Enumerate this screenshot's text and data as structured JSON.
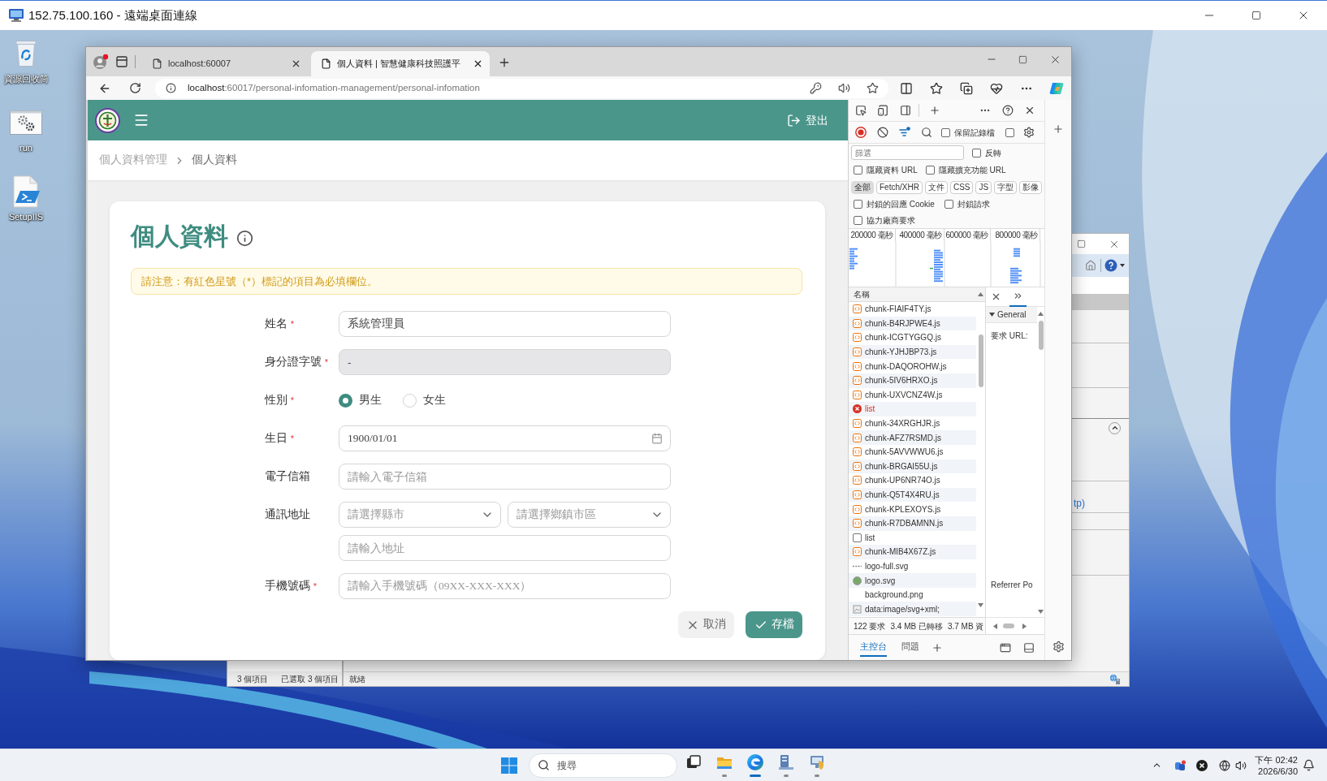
{
  "remote_desktop": {
    "title": "152.75.100.160 - 遠端桌面連線"
  },
  "desktop_icons": [
    {
      "kind": "recycle_bin",
      "label": "資源回收筒"
    },
    {
      "kind": "gears",
      "label": "run"
    },
    {
      "kind": "script",
      "label": "SetupIIS"
    }
  ],
  "browser": {
    "tabs": [
      {
        "title": "localhost:60007",
        "selected": false
      },
      {
        "title": "個人資料 | 智慧健康科技照護平",
        "selected": true
      }
    ],
    "address": {
      "host": "localhost",
      "rest": ":60017/personal-infomation-management/personal-infomation"
    }
  },
  "page": {
    "header": {
      "logout": "登出"
    },
    "breadcrumb": [
      {
        "label": "個人資料管理",
        "current": false
      },
      {
        "label": "個人資料",
        "current": true
      }
    ],
    "title": "個人資料",
    "notice": "請注意：有紅色星號（*）標記的項目為必填欄位。",
    "fields": [
      {
        "kind": "text",
        "label": "姓名",
        "required_mark": "*",
        "value": "系統管理員",
        "disabled": false
      },
      {
        "kind": "text",
        "label": "身分證字號",
        "required_mark": "*",
        "value": "-",
        "disabled": true
      },
      {
        "kind": "radio",
        "label": "性別",
        "required_mark": "*",
        "disabled": false,
        "options": [
          {
            "label": "男生",
            "selected": true
          },
          {
            "label": "女生",
            "selected": false
          }
        ]
      },
      {
        "kind": "date",
        "label": "生日",
        "required_mark": "*",
        "value": "1900/01/01",
        "disabled": false
      },
      {
        "kind": "text",
        "label": "電子信箱",
        "placeholder": "請輸入電子信箱",
        "disabled": false
      },
      {
        "kind": "address",
        "label": "通訊地址",
        "disabled": false,
        "selects": [
          {
            "placeholder": "請選擇縣市"
          },
          {
            "placeholder": "請選擇鄉鎮市區"
          }
        ],
        "placeholder": "請輸入地址"
      },
      {
        "kind": "tel",
        "label": "手機號碼",
        "required_mark": "*",
        "placeholder": "請輸入手機號碼（09XX-XXX-XXX）",
        "disabled": false
      }
    ],
    "buttons": [
      {
        "kind": "cancel",
        "label": "取消"
      },
      {
        "kind": "save",
        "label": "存檔"
      }
    ]
  },
  "devtools": {
    "record_options": [
      {
        "label": "保留記錄檔",
        "checked": false
      },
      {
        "checked": false
      }
    ],
    "filter": {
      "placeholder": "篩選"
    },
    "invert": {
      "label": "反轉",
      "checked": false
    },
    "hide_options": [
      {
        "label": "隱藏資料 URL",
        "checked": false
      },
      {
        "label": "隱藏擴充功能 URL",
        "checked": false
      }
    ],
    "type_filters": [
      {
        "label": "全部",
        "selected": true
      },
      {
        "label": "Fetch/XHR",
        "selected": false
      },
      {
        "label": "文件",
        "selected": false
      },
      {
        "label": "CSS",
        "selected": false
      },
      {
        "label": "JS",
        "selected": false
      },
      {
        "label": "字型",
        "selected": false
      },
      {
        "label": "影像",
        "selected": false
      }
    ],
    "block_options": [
      {
        "label": "封鎖的回應 Cookie",
        "checked": false
      },
      {
        "label": "封鎖請求",
        "checked": false
      }
    ],
    "third_party": {
      "label": "協力廠商要求",
      "checked": false
    },
    "overview_ticks": [
      "200000 毫秒",
      "400000 毫秒",
      "600000 毫秒",
      "800000 毫秒"
    ],
    "requests": {
      "column": "名稱",
      "rows": [
        {
          "name": "chunk-FIAIF4TY.js",
          "kind": "script"
        },
        {
          "name": "chunk-B4RJPWE4.js",
          "kind": "script"
        },
        {
          "name": "chunk-ICGTYGGQ.js",
          "kind": "script"
        },
        {
          "name": "chunk-YJHJBP73.js",
          "kind": "script"
        },
        {
          "name": "chunk-DAQOROHW.js",
          "kind": "script"
        },
        {
          "name": "chunk-5IV6HRXO.js",
          "kind": "script"
        },
        {
          "name": "chunk-UXVCNZ4W.js",
          "kind": "script"
        },
        {
          "name": "list",
          "kind": "failed"
        },
        {
          "name": "chunk-34XRGHJR.js",
          "kind": "script"
        },
        {
          "name": "chunk-AFZ7RSMD.js",
          "kind": "script"
        },
        {
          "name": "chunk-5AVVWWU6.js",
          "kind": "script"
        },
        {
          "name": "chunk-BRGAI55U.js",
          "kind": "script"
        },
        {
          "name": "chunk-UP6NR74O.js",
          "kind": "script"
        },
        {
          "name": "chunk-Q5T4X4RU.js",
          "kind": "script"
        },
        {
          "name": "chunk-KPLEXOYS.js",
          "kind": "script"
        },
        {
          "name": "chunk-R7DBAMNN.js",
          "kind": "script"
        },
        {
          "name": "list",
          "kind": "fetch"
        },
        {
          "name": "chunk-MIB4X67Z.js",
          "kind": "script"
        },
        {
          "name": "logo-full.svg",
          "kind": "image_line"
        },
        {
          "name": "logo.svg",
          "kind": "image_round"
        },
        {
          "name": "background.png",
          "kind": "plain"
        },
        {
          "name": "data:image/svg+xml;",
          "kind": "data"
        }
      ]
    },
    "details": {
      "section": "General",
      "fields": [
        "要求 URL:",
        "Referrer Po"
      ]
    },
    "summary": [
      "122 要求",
      "3.4 MB 已轉移",
      "3.7 MB 資"
    ],
    "drawer_tabs": [
      {
        "label": "主控台",
        "selected": true
      },
      {
        "label": "問題",
        "selected": false
      }
    ]
  },
  "explorer_window": {
    "status": [
      "3 個項目",
      "已選取 3 個項目"
    ]
  },
  "iis_window": {
    "link": "tp)",
    "status": "就緒"
  },
  "taskbar": {
    "search": {
      "placeholder": "搜尋"
    },
    "apps": [
      {
        "kind": "task_view",
        "running": false,
        "selected": false
      },
      {
        "kind": "folder",
        "running": true,
        "selected": false
      },
      {
        "kind": "browser",
        "running": true,
        "selected": true
      },
      {
        "kind": "server",
        "running": true,
        "selected": false
      },
      {
        "kind": "network",
        "running": true,
        "selected": false
      }
    ],
    "clock": {
      "time": "下午 02:42",
      "date": "2026/6/30"
    }
  }
}
